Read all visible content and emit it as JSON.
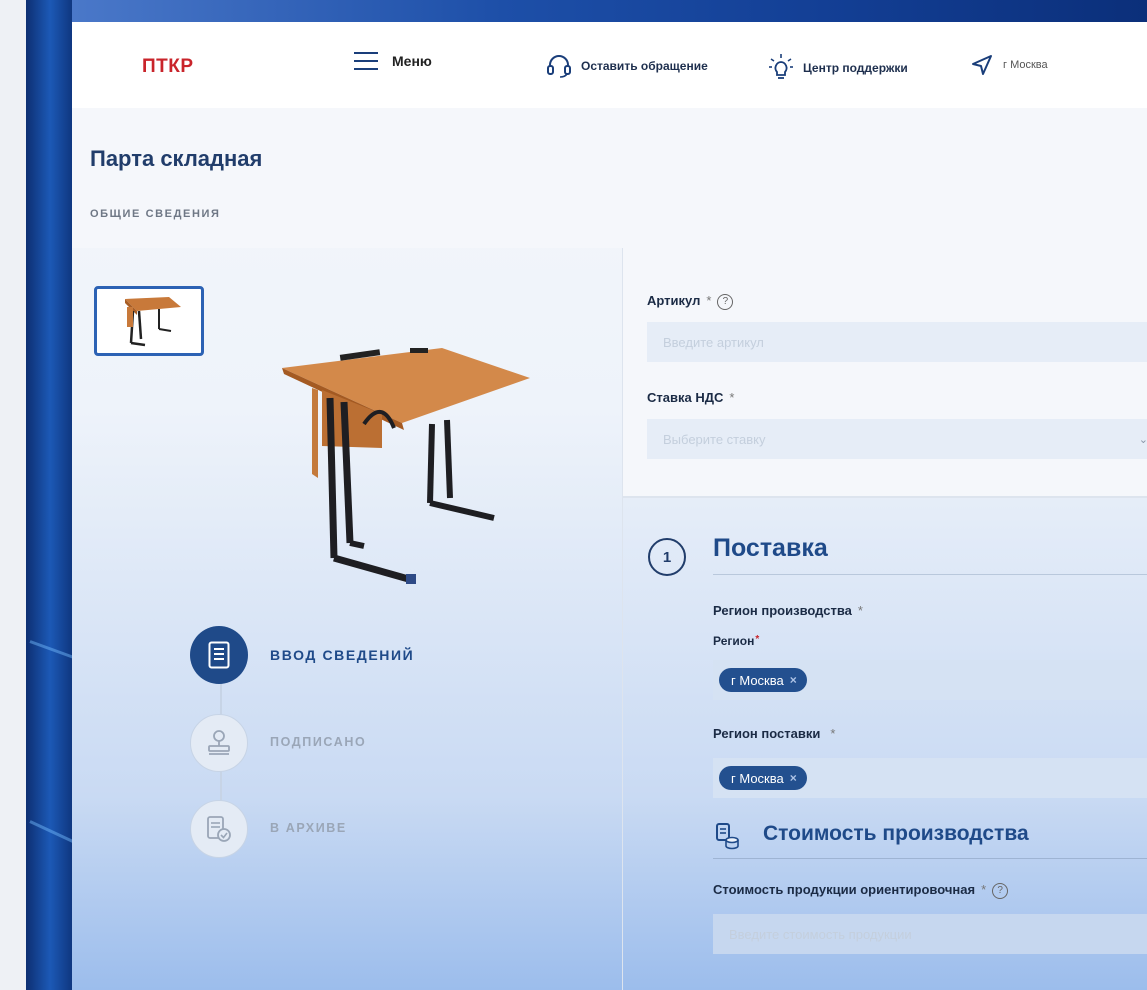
{
  "header": {
    "logo": "ПТКР",
    "menu_label": "Меню",
    "appeal_label": "Оставить обращение",
    "support_label": "Центр поддержки",
    "city_label": "г Москва"
  },
  "page": {
    "title": "Парта складная",
    "section": "ОБЩИЕ СВЕДЕНИЯ"
  },
  "statuses": [
    {
      "label": "ВВОД СВЕДЕНИЙ",
      "icon": "document-icon",
      "active": true
    },
    {
      "label": "ПОДПИСАНО",
      "icon": "stamp-icon",
      "active": false
    },
    {
      "label": "В АРХИВЕ",
      "icon": "archive-icon",
      "active": false
    }
  ],
  "form": {
    "article": {
      "label": "Артикул",
      "required": "*",
      "help": "?",
      "placeholder": "Введите артикул"
    },
    "vat": {
      "label": "Ставка НДС",
      "required": "*",
      "placeholder": "Выберите ставку"
    }
  },
  "delivery": {
    "step_number": "1",
    "title": "Поставка",
    "production_region_label": "Регион производства",
    "production_region_req": "*",
    "region_sublabel": "Регион",
    "region_sublabel_req": "*",
    "production_region_tag": "г Москва",
    "delivery_region_label": "Регион поставки",
    "delivery_region_req": "*",
    "delivery_region_tag": "г Москва",
    "tag_remove": "×"
  },
  "cost": {
    "title": "Стоимость производства",
    "product_cost_label": "Стоимость продукции ориентировочная",
    "product_cost_req": "*",
    "product_cost_help": "?",
    "product_cost_placeholder": "Введите стоимость продукции"
  },
  "colors": {
    "brand_red": "#c9242b",
    "primary_blue": "#1f4a89",
    "input_bg": "#e6edf7",
    "tag_bg": "#23508f"
  }
}
